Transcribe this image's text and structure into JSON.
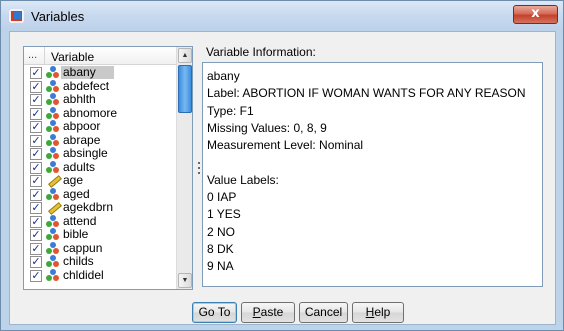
{
  "window": {
    "title": "Variables",
    "close_label": "x"
  },
  "variable_list": {
    "header_dots": "...",
    "header_label": "Variable",
    "items": [
      {
        "label": "abany",
        "checked": true,
        "icon": "nominal-icon",
        "selected": true
      },
      {
        "label": "abdefect",
        "checked": true,
        "icon": "nominal-icon"
      },
      {
        "label": "abhlth",
        "checked": true,
        "icon": "nominal-icon"
      },
      {
        "label": "abnomore",
        "checked": true,
        "icon": "nominal-icon"
      },
      {
        "label": "abpoor",
        "checked": true,
        "icon": "nominal-icon"
      },
      {
        "label": "abrape",
        "checked": true,
        "icon": "nominal-icon"
      },
      {
        "label": "absingle",
        "checked": true,
        "icon": "nominal-icon"
      },
      {
        "label": "adults",
        "checked": true,
        "icon": "nominal-icon"
      },
      {
        "label": "age",
        "checked": true,
        "icon": "scale-icon"
      },
      {
        "label": "aged",
        "checked": true,
        "icon": "nominal-icon"
      },
      {
        "label": "agekdbrn",
        "checked": true,
        "icon": "scale-icon"
      },
      {
        "label": "attend",
        "checked": true,
        "icon": "nominal-icon"
      },
      {
        "label": "bible",
        "checked": true,
        "icon": "nominal-icon"
      },
      {
        "label": "cappun",
        "checked": true,
        "icon": "nominal-icon"
      },
      {
        "label": "childs",
        "checked": true,
        "icon": "nominal-icon"
      },
      {
        "label": "chldidel",
        "checked": true,
        "icon": "nominal-icon"
      }
    ]
  },
  "info": {
    "title": "Variable Information:",
    "lines": [
      "abany",
      "Label: ABORTION IF WOMAN WANTS FOR ANY REASON",
      "Type: F1",
      "Missing Values: 0, 8, 9",
      "Measurement Level: Nominal",
      "",
      "Value Labels:",
      "0  IAP",
      "1  YES",
      "2  NO",
      "8  DK",
      "9  NA"
    ]
  },
  "buttons": {
    "goto": "Go To",
    "paste_mn": "P",
    "paste_rest": "aste",
    "cancel": "Cancel",
    "help_mn": "H",
    "help_rest": "elp"
  },
  "colors": {
    "accent": "#3a8fe0",
    "close": "#c4412a"
  }
}
